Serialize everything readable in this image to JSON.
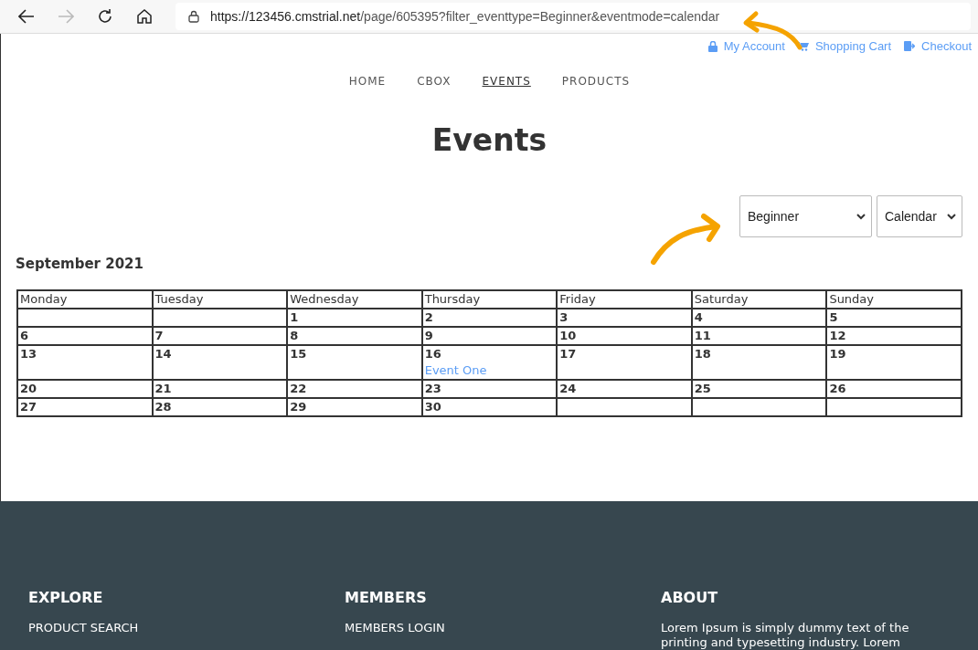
{
  "browser": {
    "url_host": "https://123456.cmstrial.net",
    "url_path": "/page/605395?filter_eventtype=Beginner&eventmode=calendar"
  },
  "account_links": [
    {
      "kind": "account",
      "label": "My Account"
    },
    {
      "kind": "cart",
      "label": "Shopping Cart"
    },
    {
      "kind": "checkout",
      "label": "Checkout"
    }
  ],
  "nav": [
    {
      "label": "HOME",
      "selected": false
    },
    {
      "label": "CBOX",
      "selected": false
    },
    {
      "label": "EVENTS",
      "selected": true
    },
    {
      "label": "PRODUCTS",
      "selected": false
    }
  ],
  "page_title": "Events",
  "filters": [
    {
      "value": "Beginner"
    },
    {
      "value": "Calendar"
    }
  ],
  "calendar": {
    "month": "September 2021",
    "columns": [
      "Monday",
      "Tuesday",
      "Wednesday",
      "Thursday",
      "Friday",
      "Saturday",
      "Sunday"
    ],
    "weeks": [
      {
        "days": [
          {
            "kind": "blank"
          },
          {
            "kind": "blank"
          },
          {
            "kind": "day",
            "day": "1"
          },
          {
            "kind": "day",
            "day": "2"
          },
          {
            "kind": "day",
            "day": "3"
          },
          {
            "kind": "day",
            "day": "4"
          },
          {
            "kind": "day",
            "day": "5"
          }
        ]
      },
      {
        "days": [
          {
            "kind": "day",
            "day": "6"
          },
          {
            "kind": "day",
            "day": "7"
          },
          {
            "kind": "day",
            "day": "8"
          },
          {
            "kind": "day",
            "day": "9"
          },
          {
            "kind": "day",
            "day": "10"
          },
          {
            "kind": "day",
            "day": "11"
          },
          {
            "kind": "day",
            "day": "12"
          }
        ]
      },
      {
        "days": [
          {
            "kind": "day",
            "day": "13"
          },
          {
            "kind": "day",
            "day": "14"
          },
          {
            "kind": "day",
            "day": "15"
          },
          {
            "kind": "day",
            "day": "16",
            "events": [
              "Event One"
            ]
          },
          {
            "kind": "day",
            "day": "17"
          },
          {
            "kind": "day",
            "day": "18"
          },
          {
            "kind": "day",
            "day": "19"
          }
        ]
      },
      {
        "days": [
          {
            "kind": "day",
            "day": "20"
          },
          {
            "kind": "day",
            "day": "21"
          },
          {
            "kind": "day",
            "day": "22"
          },
          {
            "kind": "day",
            "day": "23"
          },
          {
            "kind": "day",
            "day": "24"
          },
          {
            "kind": "day",
            "day": "25"
          },
          {
            "kind": "day",
            "day": "26"
          }
        ]
      },
      {
        "days": [
          {
            "kind": "day",
            "day": "27"
          },
          {
            "kind": "day",
            "day": "28"
          },
          {
            "kind": "day",
            "day": "29"
          },
          {
            "kind": "day",
            "day": "30"
          },
          {
            "kind": "blank"
          },
          {
            "kind": "blank"
          },
          {
            "kind": "blank"
          }
        ]
      }
    ]
  },
  "footer": [
    {
      "heading": "EXPLORE",
      "kind": "links",
      "items": [
        "PRODUCT SEARCH"
      ]
    },
    {
      "heading": "MEMBERS",
      "kind": "links",
      "items": [
        "MEMBERS LOGIN"
      ]
    },
    {
      "heading": "ABOUT",
      "kind": "text",
      "items": [
        "Lorem Ipsum is simply dummy text of the printing and typesetting industry. Lorem"
      ]
    }
  ]
}
